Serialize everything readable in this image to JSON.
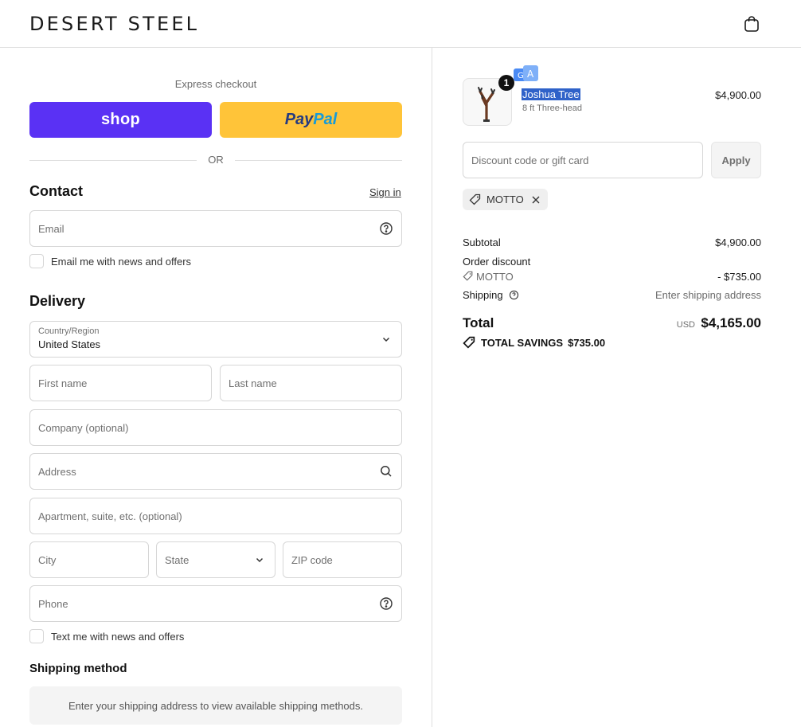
{
  "header": {
    "logo": "DESERT STEEL",
    "cart_icon": "shopping-bag-icon"
  },
  "express": {
    "title": "Express checkout",
    "shop_label": "shop",
    "paypal_label_1": "Pay",
    "paypal_label_2": "Pal",
    "or_label": "OR"
  },
  "contact": {
    "title": "Contact",
    "sign_in": "Sign in",
    "email_placeholder": "Email",
    "email_opt_in": "Email me with news and offers"
  },
  "delivery": {
    "title": "Delivery",
    "country_label": "Country/Region",
    "country_value": "United States",
    "first_name": "First name",
    "last_name": "Last name",
    "company": "Company (optional)",
    "address": "Address",
    "apartment": "Apartment, suite, etc. (optional)",
    "city": "City",
    "state": "State",
    "zip": "ZIP code",
    "phone": "Phone",
    "text_opt_in": "Text me with news and offers"
  },
  "shipping_method": {
    "title": "Shipping method",
    "message": "Enter your shipping address to view available shipping methods."
  },
  "cart": {
    "item": {
      "quantity": "1",
      "name": "Joshua Tree",
      "variant": "8 ft Three-head",
      "price": "$4,900.00",
      "image_icon": "joshua-tree-sculpture"
    },
    "discount_placeholder": "Discount code or gift card",
    "apply_label": "Apply",
    "applied_code": "MOTTO"
  },
  "summary": {
    "subtotal_label": "Subtotal",
    "subtotal_value": "$4,900.00",
    "order_discount_label": "Order discount",
    "discount_code": "MOTTO",
    "discount_value": "- $735.00",
    "shipping_label": "Shipping",
    "shipping_value": "Enter shipping address",
    "total_label": "Total",
    "currency": "USD",
    "total_value": "$4,165.00",
    "savings_label": "TOTAL SAVINGS",
    "savings_value": "$735.00"
  },
  "colors": {
    "shop_purple": "#5a31f4",
    "paypal_yellow": "#ffc439",
    "selection_blue": "#2f62c9"
  }
}
